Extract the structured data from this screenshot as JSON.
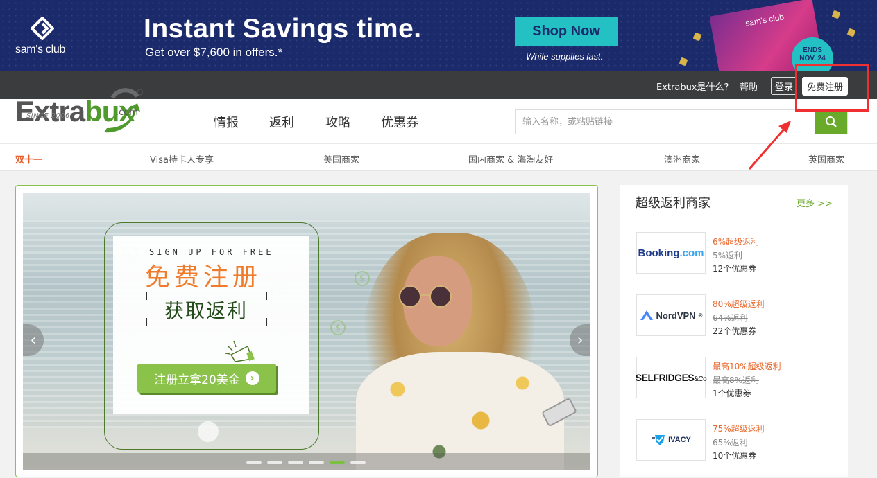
{
  "ad": {
    "brand": "sam's club",
    "headline": "Instant Savings time.",
    "subline": "Get over $7,600 in offers.*",
    "cta": "Shop Now",
    "supplies": "While supplies last.",
    "magazine_brand": "sam's club",
    "ends_line1": "ENDS",
    "ends_line2": "NOV. 24",
    "colors": {
      "background": "#1b2a6b",
      "cta": "#23c0c4"
    }
  },
  "topbar": {
    "what_is": "Extrabux是什么?",
    "help": "帮助",
    "login": "登录",
    "signup": "免费注册"
  },
  "header": {
    "logo_main": "Extra",
    "logo_accent": "bux",
    "logo_com": ".com",
    "logo_since": "— SINCE 2006 —",
    "nav": [
      "情报",
      "返利",
      "攻略",
      "优惠券"
    ],
    "search_placeholder": "输入名称，或粘贴链接",
    "colors": {
      "accent": "#6aaa2a"
    }
  },
  "categories": [
    "双十一",
    "Visa持卡人专享",
    "美国商家",
    "国内商家 & 海淘友好",
    "澳洲商家",
    "英国商家"
  ],
  "hero": {
    "sign_up": "SIGN UP FOR FREE",
    "big": "免费注册",
    "get": "获取返利",
    "cta": "注册立拿20美金",
    "coin_symbol": "$",
    "prev": "‹",
    "next": "›"
  },
  "sidebar": {
    "title": "超级返利商家",
    "more": "更多 >>",
    "merchants": [
      {
        "name": "Booking.com",
        "logo_a": "Booking",
        "logo_b": ".com",
        "super": "6%超级返利",
        "old": "5%返利",
        "coupons": "12个优惠券"
      },
      {
        "name": "NordVPN",
        "logo_a": "NordVPN",
        "logo_b": "®",
        "super": "80%超级返利",
        "old": "64%返利",
        "coupons": "22个优惠券"
      },
      {
        "name": "SELFRIDGES",
        "logo_a": "SELFRIDGES",
        "logo_b": "&Co",
        "super": "最高10%超级返利",
        "old": "最高8%返利",
        "coupons": "1个优惠券"
      },
      {
        "name": "IVACY",
        "logo_a": "IVACY",
        "logo_b": "",
        "super": "75%超级返利",
        "old": "65%返利",
        "coupons": "10个优惠券"
      }
    ]
  }
}
